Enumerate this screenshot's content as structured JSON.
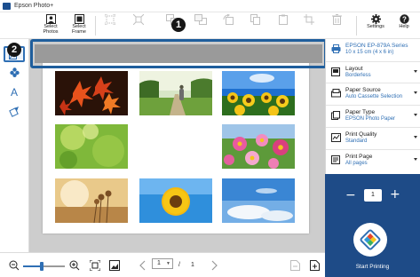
{
  "window": {
    "title": "Epson Photo+"
  },
  "toolbar": {
    "select_photos": [
      "Select",
      "Photos"
    ],
    "select_frame": [
      "Select",
      "Frame"
    ],
    "settings": "Settings",
    "help": "Help"
  },
  "callouts": {
    "one": "1",
    "two": "2"
  },
  "left_tools": [
    "add-image-icon",
    "stamp-icon",
    "text-icon",
    "brush-icon"
  ],
  "canvas": {
    "photos": [
      "autumn-leaves",
      "walking-path",
      "sunflower-field",
      "green-bokeh",
      "cosmos-flowers",
      "dry-flowers-sunset",
      "sunflower-closeup",
      "blue-sky"
    ]
  },
  "bottom": {
    "page_current": "1",
    "page_separator": "/",
    "page_total": "1",
    "zoom_level": 0.45
  },
  "printer": {
    "model": "EPSON EP-879A Series",
    "size": "10 x 15 cm (4 x 6 in)"
  },
  "settings": [
    {
      "label": "Layout",
      "value": "Borderless"
    },
    {
      "label": "Paper Source",
      "value": "Auto Cassette Selection"
    },
    {
      "label": "Paper Type",
      "value": "EPSON Photo Paper"
    },
    {
      "label": "Print Quality",
      "value": "Standard"
    },
    {
      "label": "Print Page",
      "value": "All pages"
    }
  ],
  "print": {
    "copies": "1",
    "minus": "−",
    "plus": "+",
    "start_label": "Start Printing"
  },
  "colors": {
    "accent": "#2f6fb4",
    "print_panel": "#1e4b87",
    "highlight": "#1f5e9c",
    "canvas": "#cdcdcd"
  }
}
